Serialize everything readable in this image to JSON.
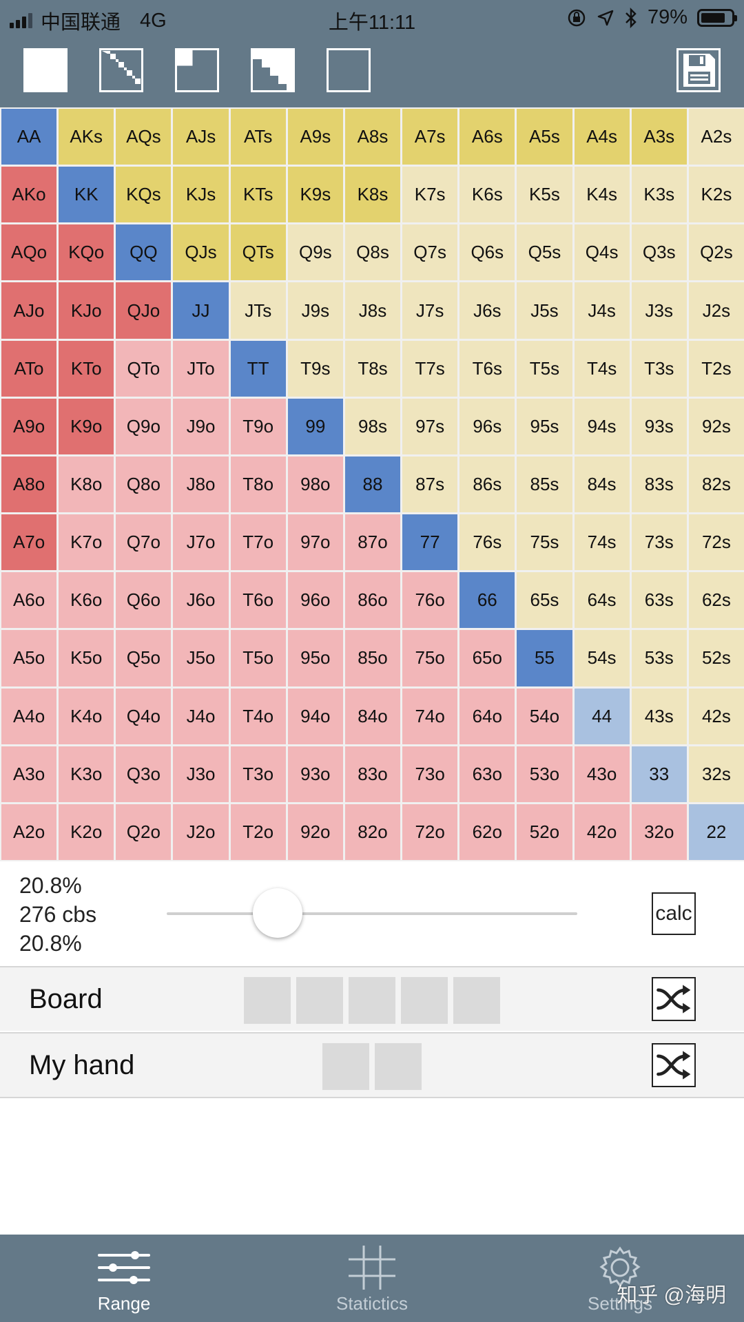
{
  "status_bar": {
    "carrier": "中国联通",
    "network": "4G",
    "time": "上午11:11",
    "battery": "79%"
  },
  "toolbar": {
    "buttons": [
      "fill-all-icon",
      "diagonal-icon",
      "corner-icon",
      "triangle-icon",
      "empty-icon"
    ],
    "save_icon": "floppy-disk-icon"
  },
  "colors": {
    "header": "#647988",
    "pair": "#5a86c9",
    "pair_light": "#a9c1e0",
    "suited_selected": "#e3d26e",
    "suited": "#efe5be",
    "offsuit_selected": "#e07070",
    "offsuit": "#f2b6b8"
  },
  "grid": {
    "ranks": [
      "A",
      "K",
      "Q",
      "J",
      "T",
      "9",
      "8",
      "7",
      "6",
      "5",
      "4",
      "3",
      "2"
    ],
    "suited_selected": [
      "AKs",
      "AQs",
      "AJs",
      "ATs",
      "A9s",
      "A8s",
      "A7s",
      "A6s",
      "A5s",
      "A4s",
      "A3s",
      "KQs",
      "KJs",
      "KTs",
      "K9s",
      "K8s",
      "QJs",
      "QTs"
    ],
    "offsuit_selected": [
      "AKo",
      "AQo",
      "KQo",
      "AJo",
      "KJo",
      "QJo",
      "ATo",
      "KTo",
      "A9o",
      "K9o",
      "A8o",
      "A7o"
    ],
    "pairs_light": [
      "44",
      "33",
      "22"
    ]
  },
  "panel": {
    "percent_1": "20.8%",
    "combos": "276 cbs",
    "percent_2": "20.8%",
    "slider_fraction": 0.27,
    "calc_label": "calc"
  },
  "board": {
    "label": "Board",
    "slots": 5
  },
  "hand": {
    "label": "My hand",
    "slots": 2
  },
  "tabs": [
    {
      "label": "Range",
      "icon": "sliders-icon",
      "active": true
    },
    {
      "label": "Statictics",
      "icon": "grid-hash-icon",
      "active": false
    },
    {
      "label": "Settings",
      "icon": "gear-icon",
      "active": false
    }
  ],
  "watermark": "知乎 @海明"
}
